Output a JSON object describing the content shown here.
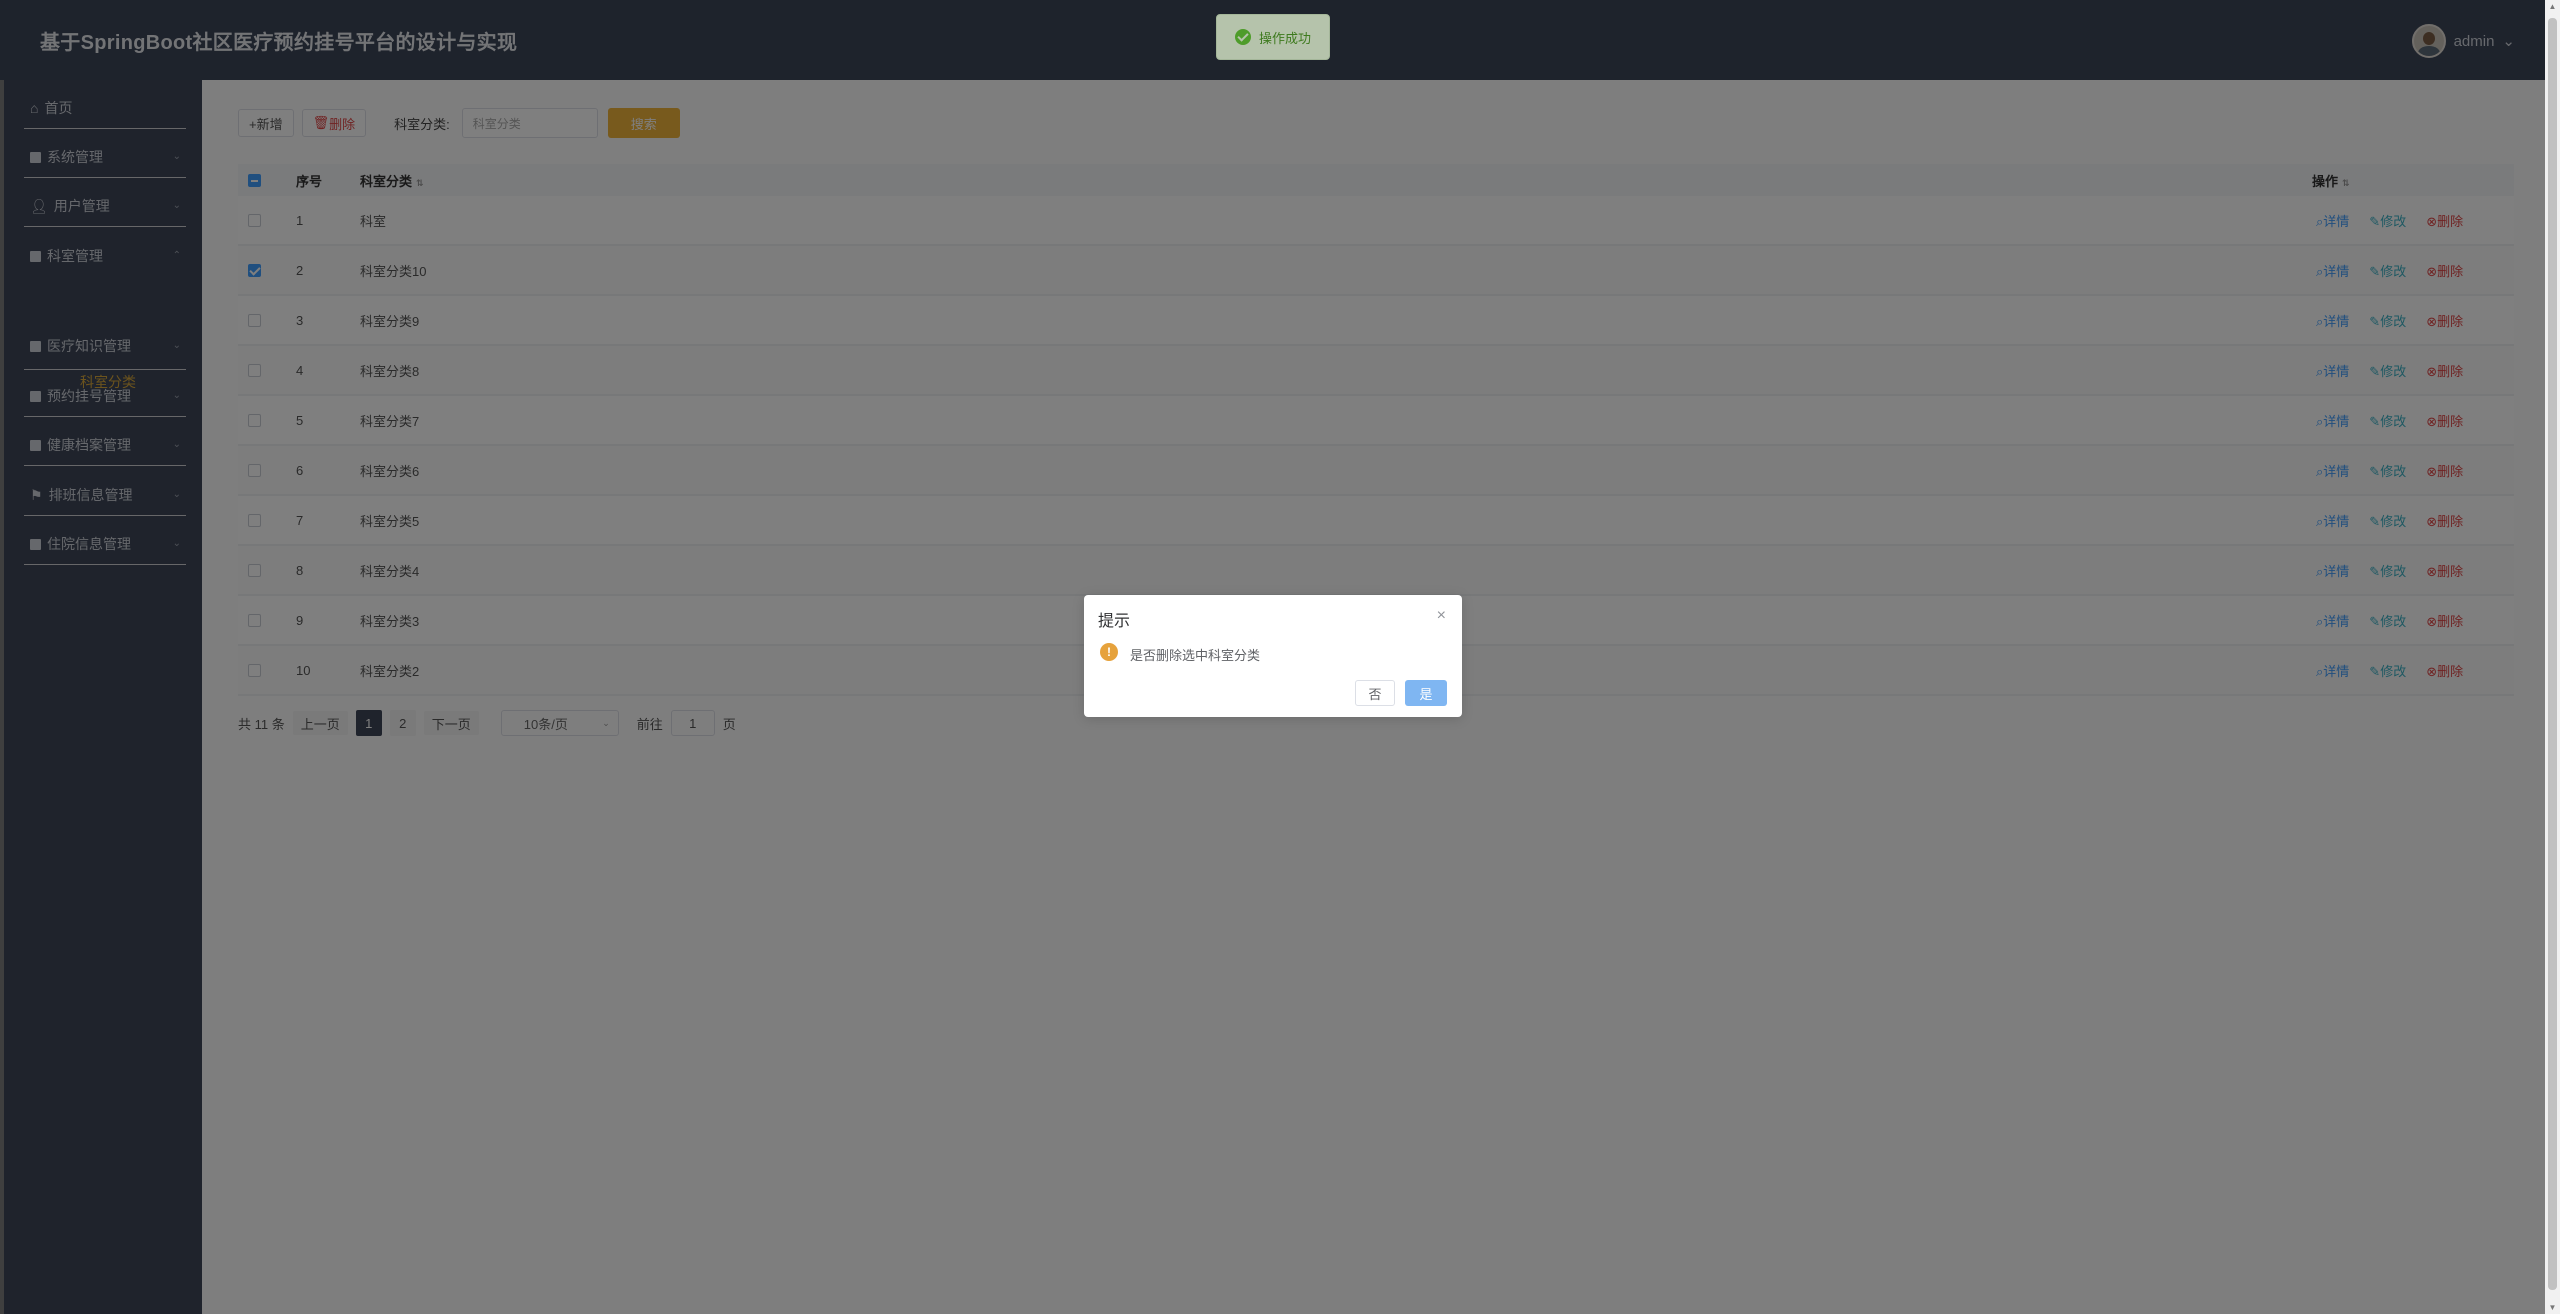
{
  "app": {
    "title": "基于SpringBoot社区医疗预约挂号平台的设计与实现",
    "user": "admin"
  },
  "toast": {
    "message": "操作成功"
  },
  "sidebar": {
    "items": [
      {
        "label": "首页",
        "icon": "home-icon"
      },
      {
        "label": "系统管理",
        "icon": "grid-icon"
      },
      {
        "label": "用户管理",
        "icon": "user-icon"
      },
      {
        "label": "科室管理",
        "icon": "grid-icon"
      },
      {
        "label": "医疗知识管理",
        "icon": "apps-icon"
      },
      {
        "label": "预约挂号管理",
        "icon": "grid-icon"
      },
      {
        "label": "健康档案管理",
        "icon": "grid-icon"
      },
      {
        "label": "排班信息管理",
        "icon": "tag-icon"
      },
      {
        "label": "住院信息管理",
        "icon": "grid-icon"
      }
    ],
    "sub_item": "科室分类"
  },
  "toolbar": {
    "add_label": "+新增",
    "delete_label": "删除",
    "filter_label": "科室分类:",
    "filter_placeholder": "科室分类",
    "search_label": "搜索"
  },
  "table": {
    "headers": {
      "index": "序号",
      "name": "科室分类",
      "ops": "操作"
    },
    "rows": [
      {
        "index": "1",
        "name": "科室",
        "checked": false
      },
      {
        "index": "2",
        "name": "科室分类10",
        "checked": true
      },
      {
        "index": "3",
        "name": "科室分类9",
        "checked": false
      },
      {
        "index": "4",
        "name": "科室分类8",
        "checked": false
      },
      {
        "index": "5",
        "name": "科室分类7",
        "checked": false
      },
      {
        "index": "6",
        "name": "科室分类6",
        "checked": false
      },
      {
        "index": "7",
        "name": "科室分类5",
        "checked": false
      },
      {
        "index": "8",
        "name": "科室分类4",
        "checked": false
      },
      {
        "index": "9",
        "name": "科室分类3",
        "checked": false
      },
      {
        "index": "10",
        "name": "科室分类2",
        "checked": false
      }
    ],
    "ops": {
      "detail": "详情",
      "edit": "修改",
      "delete": "删除"
    }
  },
  "pager": {
    "total": "共 11 条",
    "prev": "上一页",
    "pages": [
      "1",
      "2"
    ],
    "current": "1",
    "next": "下一页",
    "size": "10条/页",
    "goto": "前往",
    "goto_value": "1",
    "page_suffix": "页"
  },
  "dialog": {
    "title": "提示",
    "message": "是否删除选中科室分类",
    "no": "否",
    "yes": "是"
  },
  "colors": {
    "topbar": "#3d4659",
    "sidebar": "#3f4659",
    "accent": "#f0b43a",
    "primary": "#409eff",
    "danger": "#e04545"
  }
}
